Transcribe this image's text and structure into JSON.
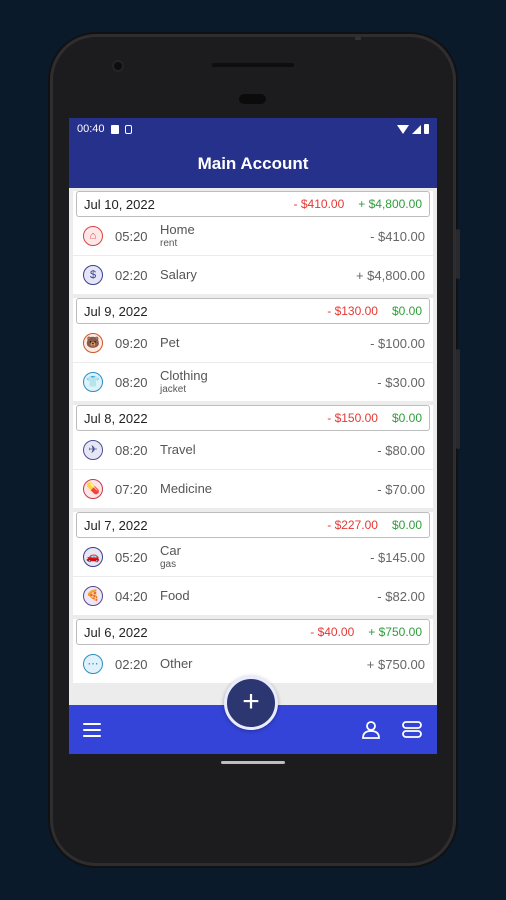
{
  "status_bar": {
    "time": "00:40"
  },
  "app": {
    "title": "Main Account"
  },
  "days": [
    {
      "date": "Jul 10, 2022",
      "expense": "- $410.00",
      "income": "+ $4,800.00",
      "transactions": [
        {
          "icon": "home-icon",
          "glyph": "⌂",
          "bg": "#fde7e7",
          "fg": "#d64545",
          "time": "05:20",
          "category": "Home",
          "note": "rent",
          "amount": "- $410.00"
        },
        {
          "icon": "salary-icon",
          "glyph": "$",
          "bg": "#e4e5f7",
          "fg": "#3b3f8f",
          "time": "02:20",
          "category": "Salary",
          "note": "",
          "amount": "+ $4,800.00"
        }
      ]
    },
    {
      "date": "Jul 9, 2022",
      "expense": "- $130.00",
      "income": "$0.00",
      "transactions": [
        {
          "icon": "pet-icon",
          "glyph": "🐻",
          "bg": "#fde9df",
          "fg": "#c8582b",
          "time": "09:20",
          "category": "Pet",
          "note": "",
          "amount": "- $100.00"
        },
        {
          "icon": "clothing-icon",
          "glyph": "👕",
          "bg": "#dff1fa",
          "fg": "#2b8fc0",
          "time": "08:20",
          "category": "Clothing",
          "note": "jacket",
          "amount": "- $30.00"
        }
      ]
    },
    {
      "date": "Jul 8, 2022",
      "expense": "- $150.00",
      "income": "$0.00",
      "transactions": [
        {
          "icon": "travel-icon",
          "glyph": "✈",
          "bg": "#e6e6f5",
          "fg": "#4a4f95",
          "time": "08:20",
          "category": "Travel",
          "note": "",
          "amount": "- $80.00"
        },
        {
          "icon": "medicine-icon",
          "glyph": "💊",
          "bg": "#fde4e6",
          "fg": "#c23b4a",
          "time": "07:20",
          "category": "Medicine",
          "note": "",
          "amount": "- $70.00"
        }
      ]
    },
    {
      "date": "Jul 7, 2022",
      "expense": "- $227.00",
      "income": "$0.00",
      "transactions": [
        {
          "icon": "car-icon",
          "glyph": "🚗",
          "bg": "#e6e6f5",
          "fg": "#3b3f8f",
          "time": "05:20",
          "category": "Car",
          "note": "gas",
          "amount": "- $145.00"
        },
        {
          "icon": "food-icon",
          "glyph": "🍕",
          "bg": "#ece6f5",
          "fg": "#5a4595",
          "time": "04:20",
          "category": "Food",
          "note": "",
          "amount": "- $82.00"
        }
      ]
    },
    {
      "date": "Jul 6, 2022",
      "expense": "- $40.00",
      "income": "+ $750.00",
      "transactions": [
        {
          "icon": "other-icon",
          "glyph": "⋯",
          "bg": "#dff1fa",
          "fg": "#2b8fc0",
          "time": "02:20",
          "category": "Other",
          "note": "",
          "amount": "+ $750.00"
        }
      ]
    }
  ],
  "colors": {
    "appbar": "#26318c",
    "bottombar": "#3544d8",
    "expense": "#e53935",
    "income": "#2e9e3a",
    "fab": "#2c3772"
  },
  "fab": {
    "label": "+"
  }
}
